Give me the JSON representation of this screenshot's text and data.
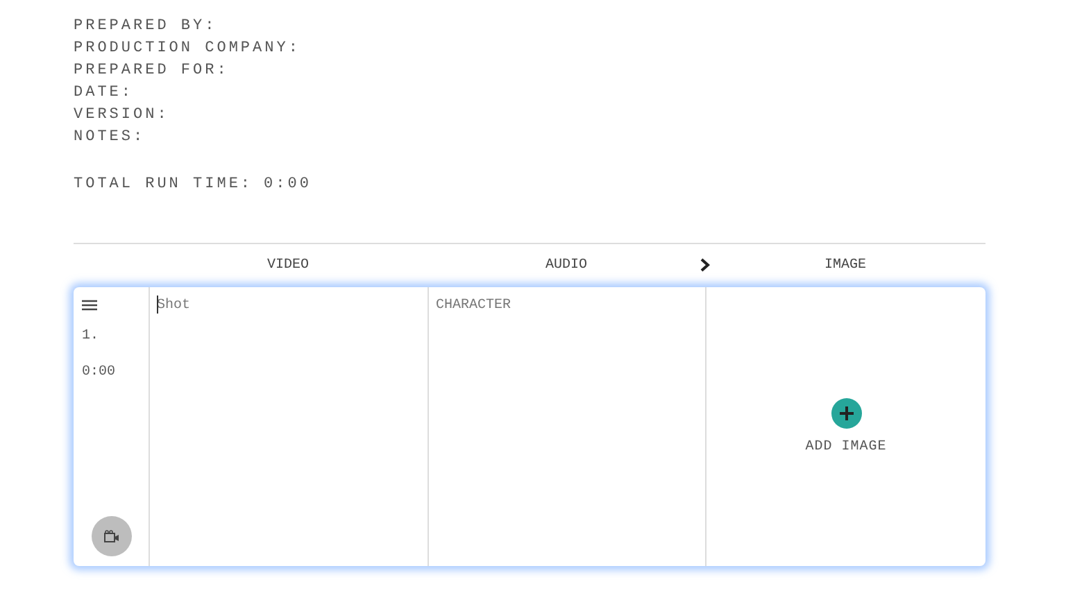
{
  "details": [
    {
      "label": "PREPARED BY:"
    },
    {
      "label": "PRODUCTION COMPANY:"
    },
    {
      "label": "PREPARED FOR:"
    },
    {
      "label": "DATE:"
    },
    {
      "label": "VERSION:"
    },
    {
      "label": "NOTES:"
    }
  ],
  "total_run_time": {
    "label": "TOTAL RUN TIME:",
    "value": "0:00"
  },
  "columns": [
    "VIDEO",
    "AUDIO",
    "IMAGE"
  ],
  "rows": [
    {
      "number": "1.",
      "time": "0:00",
      "video": {
        "placeholder": "Shot",
        "focused": true
      },
      "audio": {
        "placeholder": "CHARACTER"
      },
      "image": {
        "button_label": "ADD IMAGE"
      }
    }
  ]
}
